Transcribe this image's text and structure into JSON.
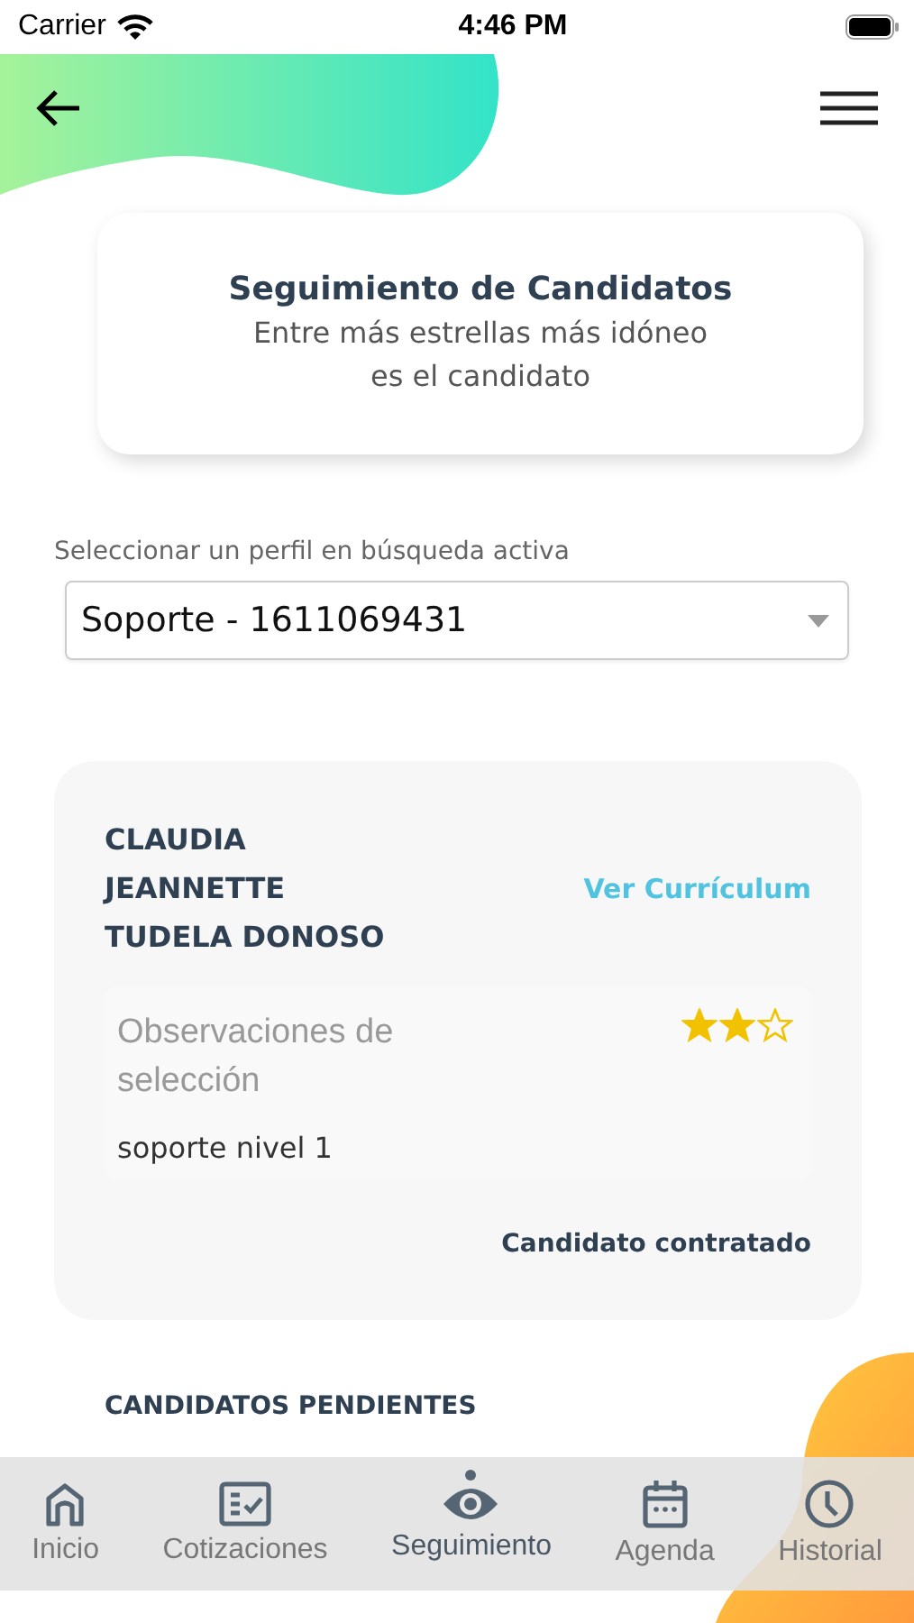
{
  "status_bar": {
    "carrier": "Carrier",
    "time": "4:46 PM"
  },
  "header": {
    "title": "Seguimiento de Candidatos",
    "subtitle": "Entre más estrellas más idóneo es el candidato"
  },
  "profile_select": {
    "label": "Seleccionar un perfil en búsqueda activa",
    "value": "Soporte - 1611069431"
  },
  "candidate": {
    "name_lines": [
      "CLAUDIA",
      "JEANNETTE",
      "TUDELA DONOSO"
    ],
    "cv_link": "Ver Currículum",
    "observations_label": "Observaciones de selección",
    "stars": 2,
    "observation": "soporte nivel 1",
    "status": "Candidato contratado"
  },
  "section_title": "CANDIDATOS PENDIENTES",
  "tabs": [
    {
      "label": "Inicio",
      "selected": false
    },
    {
      "label": "Cotizaciones",
      "selected": false
    },
    {
      "label": "Seguimiento",
      "selected": true
    },
    {
      "label": "Agenda",
      "selected": false
    },
    {
      "label": "Historial",
      "selected": false
    }
  ]
}
